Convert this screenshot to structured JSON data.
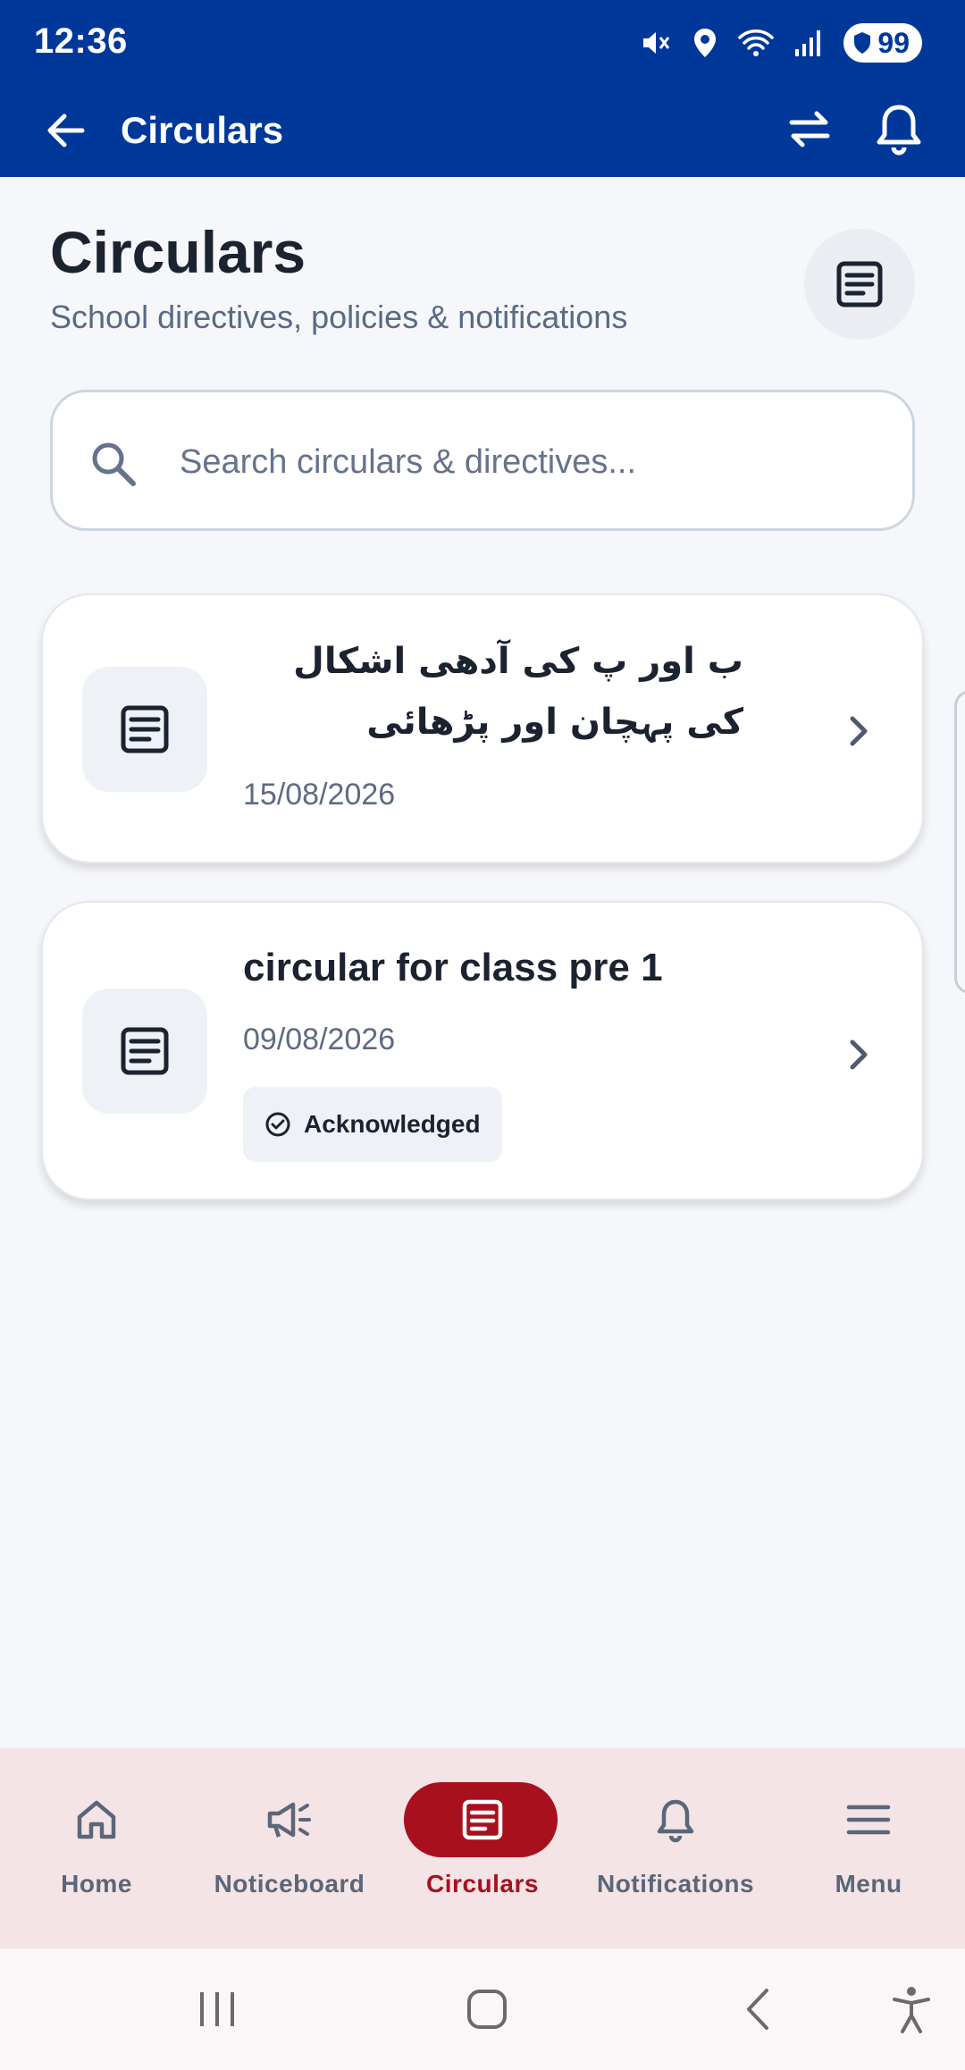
{
  "status_bar": {
    "time": "12:36",
    "battery": "99",
    "icons": [
      "mute-icon",
      "location-icon",
      "wifi-icon",
      "signal-icon",
      "battery-icon"
    ]
  },
  "app_bar": {
    "title": "Circulars",
    "actions": [
      "swap-icon",
      "bell-icon"
    ]
  },
  "header": {
    "title": "Circulars",
    "subtitle": "School directives, policies & notifications"
  },
  "search": {
    "placeholder": "Search circulars & directives...",
    "value": ""
  },
  "circulars": [
    {
      "title": "ب اور پ کی آدھی اشکال کی پہچان اور پڑھائی",
      "date": "15/08/2026",
      "badge": ""
    },
    {
      "title": "circular for class pre 1",
      "date": "09/08/2026",
      "badge": "Acknowledged"
    }
  ],
  "bottom_nav": {
    "items": [
      {
        "label": "Home",
        "icon": "home-icon"
      },
      {
        "label": "Noticeboard",
        "icon": "megaphone-icon"
      },
      {
        "label": "Circulars",
        "icon": "document-icon"
      },
      {
        "label": "Notifications",
        "icon": "bell-icon"
      },
      {
        "label": "Menu",
        "icon": "menu-icon"
      }
    ],
    "active": "Circulars"
  },
  "colors": {
    "primary": "#00389a",
    "accent": "#a8101e",
    "nav_bg": "#f4e4e6",
    "text": "#1b2230",
    "muted": "#5d6b82"
  }
}
